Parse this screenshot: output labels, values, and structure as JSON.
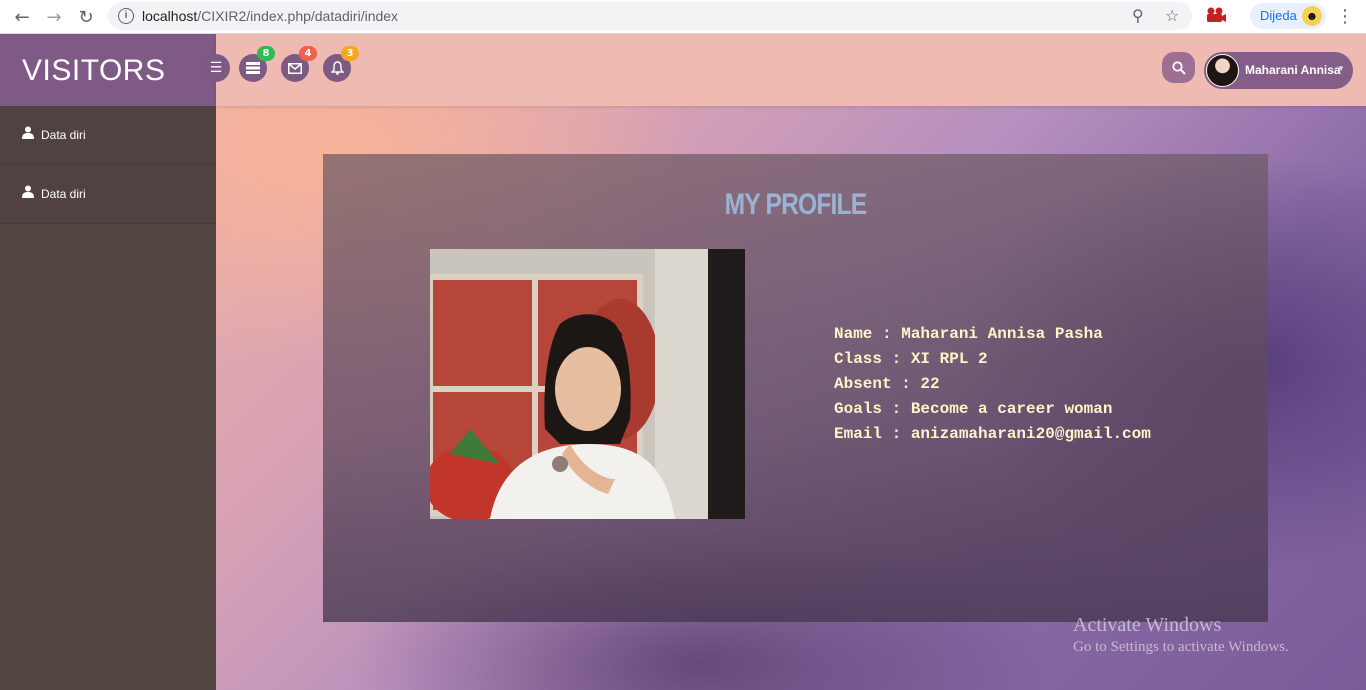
{
  "browser": {
    "url_host": "localhost",
    "url_path": "/CIXIR2/index.php/datadiri/index",
    "profile_label": "Dijeda"
  },
  "app": {
    "brand": "VISITORS",
    "topbar": {
      "badges": {
        "tasks": "8",
        "messages": "4",
        "notifications": "3"
      },
      "badge_colors": {
        "tasks": "#2dbb53",
        "messages": "#f0614f",
        "notifications": "#f5a623"
      },
      "user_name": "Maharani Annisa"
    },
    "sidebar": {
      "items": [
        {
          "label": "Data diri",
          "icon": "user-icon"
        },
        {
          "label": "Data diri",
          "icon": "user-icon"
        }
      ]
    },
    "profile": {
      "title": "MY PROFILE",
      "lines": [
        "Name : Maharani Annisa Pasha",
        "Class : XI RPL 2",
        "Absent : 22",
        "Goals : Become a career woman",
        "Email : anizamaharani20@gmail.com"
      ]
    }
  },
  "os_watermark": {
    "line1": "Activate Windows",
    "line2": "Go to Settings to activate Windows."
  }
}
